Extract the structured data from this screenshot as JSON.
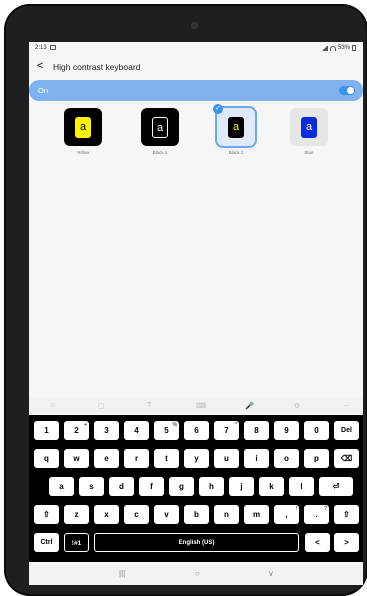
{
  "status": {
    "time": "2:13",
    "battery": "53%"
  },
  "header": {
    "back": "<",
    "title": "High contrast keyboard"
  },
  "master": {
    "label": "On",
    "enabled": true
  },
  "themes": [
    {
      "letter": "a",
      "caption": "Yellow",
      "bg": "#fff200",
      "fg": "#000000",
      "frame": "#000000"
    },
    {
      "letter": "a",
      "caption": "Black 1",
      "bg": "#000000",
      "fg": "#ffffff",
      "frame": "#000000"
    },
    {
      "letter": "a",
      "caption": "Black 2",
      "bg": "#000000",
      "fg": "#fff200",
      "frame": "#dfe9f7",
      "selected": true
    },
    {
      "letter": "a",
      "caption": "Blue",
      "bg": "#0a2bd8",
      "fg": "#ffffff",
      "frame": "#e6e6e6"
    }
  ],
  "keyboard": {
    "row1": [
      "1",
      "2",
      "3",
      "4",
      "5",
      "6",
      "7",
      "8",
      "9",
      "0",
      "Del"
    ],
    "row1_sup": [
      "",
      "+",
      "",
      "",
      "%",
      "",
      "^",
      "",
      "",
      "",
      ""
    ],
    "row2": [
      "q",
      "w",
      "e",
      "r",
      "t",
      "y",
      "u",
      "i",
      "o",
      "p",
      "⌫"
    ],
    "row3": [
      "a",
      "s",
      "d",
      "f",
      "g",
      "h",
      "j",
      "k",
      "l",
      "⏎"
    ],
    "row4": [
      "⇧",
      "z",
      "x",
      "c",
      "v",
      "b",
      "n",
      "m",
      ",",
      ".",
      "⇧"
    ],
    "row4_sup": [
      "",
      "",
      "",
      "",
      "",
      "",
      "",
      "",
      "!",
      "?",
      ""
    ],
    "row5": [
      "Ctrl",
      "!#1",
      "English (US)",
      "<",
      ">"
    ]
  },
  "toolbar": [
    "☺",
    "▢",
    "T",
    "⌨",
    "🎤",
    "⚙",
    "⋯"
  ],
  "navbar": [
    "|||",
    "○",
    "∨"
  ]
}
